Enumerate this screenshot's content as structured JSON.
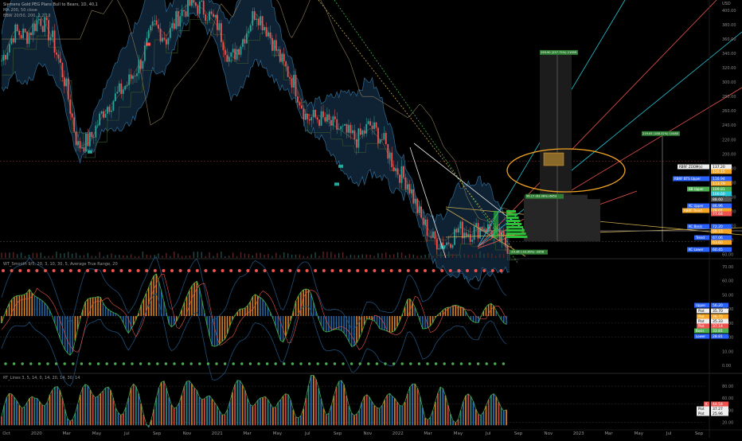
{
  "header": {
    "title": "Siemens Gold PEG Plans Bull to Bears, 1D, 40,1",
    "line2": "MA 200, 50 close",
    "line3": "BBW 20/50, 200, 2.2/13",
    "osc1_label": "WT_Smooth 9/5, 20, 3, 10, 30, 5, Average True Range, 20",
    "osc2_label": "RT_Lines 3, 5, 14, 0, 14, 20, 14, 30, 14"
  },
  "currency": "USD",
  "colors": {
    "up": "#26a69a",
    "down": "#ef5350",
    "red_dot": "#ef5350",
    "green_dot": "#4caf50",
    "orange": "#f5a623",
    "blue": "#2962ff",
    "cyan": "#26c6da",
    "band": "#1e3a52"
  },
  "chart_data": [
    {
      "type": "line",
      "name": "price",
      "x_ticks": [
        "Oct",
        "2020",
        "Mar",
        "May",
        "Jul",
        "Sep",
        "Nov",
        "2021",
        "Mar",
        "May",
        "Jul",
        "Sep",
        "Nov",
        "2022",
        "Mar",
        "May",
        "Jul",
        "Sep",
        "Nov",
        "2023",
        "Mar",
        "May",
        "Jul",
        "Sep"
      ],
      "y_ticks": [
        60,
        80,
        100,
        120,
        140,
        160,
        180,
        200,
        220,
        240,
        260,
        280,
        300,
        320,
        340,
        360,
        380,
        400
      ],
      "ylim": [
        55,
        410
      ],
      "series": [
        {
          "name": "close",
          "values": [
            330,
            370,
            365,
            390,
            360,
            300,
            210,
            220,
            260,
            280,
            300,
            330,
            380,
            360,
            395,
            410,
            400,
            380,
            330,
            360,
            400,
            370,
            330,
            300,
            250,
            250,
            240,
            230,
            220,
            240,
            220,
            180,
            160,
            110,
            80,
            75,
            95,
            90,
            100,
            85,
            70
          ]
        }
      ],
      "price_labels": [
        {
          "label": "RBRF ZOOM(s)",
          "value": "137.20",
          "color": "#ffffff"
        },
        {
          "label": "",
          "value": "126.15",
          "color": "#f5a623"
        },
        {
          "label": "RBRF BTS Upper",
          "value": "116.94",
          "color": "#2962ff"
        },
        {
          "label": "",
          "value": "113.79",
          "color": "#f5a623"
        },
        {
          "label": "BB Upper",
          "value": "109.81",
          "color": "#4caf50"
        },
        {
          "label": "",
          "value": "100.60",
          "color": "#26c6da"
        },
        {
          "label": "",
          "value": "88.60",
          "color": "#555555"
        },
        {
          "label": "KC Upper",
          "value": "86.96",
          "color": "#2962ff"
        },
        {
          "label": "RBRF Trend",
          "value": "78.01",
          "color": "#f5a623"
        },
        {
          "label": "",
          "value": "77.64",
          "color": "#ef5350"
        },
        {
          "label": "KC Basis",
          "value": "72.20",
          "color": "#2962ff"
        },
        {
          "label": "",
          "value": "69.15",
          "color": "#f5a623"
        },
        {
          "label": "Trend",
          "value": "67.06",
          "color": "#2962ff"
        },
        {
          "label": "",
          "value": "63.60",
          "color": "#f5a623"
        },
        {
          "label": "KC Lower",
          "value": "60.45",
          "color": "#2962ff"
        }
      ],
      "annotations": [
        {
          "text": "299.90 (257.75%) 21999",
          "x": "Sep 2022",
          "y": 338
        },
        {
          "text": "219.05 (188.32%) 10480",
          "x": "Jan 2023",
          "y": 225
        },
        {
          "text": "96.17 (63.98%) 6853",
          "x": "Sep 2022",
          "y": 143
        },
        {
          "text": "-29.36 (-33.36%) -2858",
          "x": "Jul 2022",
          "y": 62
        }
      ]
    },
    {
      "type": "area",
      "name": "WT oscillator",
      "y_ticks": [
        0,
        10,
        20,
        30,
        40,
        50,
        60,
        70
      ],
      "ylim": [
        -5,
        75
      ],
      "series": [
        {
          "name": "wt",
          "values": [
            30,
            45,
            60,
            40,
            25,
            10,
            40,
            55,
            35,
            20,
            50,
            60,
            30,
            45,
            55,
            20,
            15,
            40,
            55,
            35,
            20,
            45,
            50,
            30,
            20,
            15,
            35,
            20,
            30,
            45,
            25,
            40,
            35,
            45,
            30,
            40,
            35
          ]
        }
      ],
      "price_labels": [
        {
          "label": "Upper",
          "value": "56.20",
          "color": "#2962ff"
        },
        {
          "label": "Plot",
          "value": "35.70",
          "color": "#ffffff"
        },
        {
          "label": "Plot",
          "value": "36.70",
          "color": "#f5a623"
        },
        {
          "label": "Plot",
          "value": "35.33",
          "color": "#ffffff"
        },
        {
          "label": "Plot",
          "value": "37.14",
          "color": "#ef5350"
        },
        {
          "label": "Basis",
          "value": "33.81",
          "color": "#4caf50"
        },
        {
          "label": "Lower",
          "value": "28.81",
          "color": "#2962ff"
        }
      ]
    },
    {
      "type": "area",
      "name": "RT oscillator",
      "y_ticks": [
        20,
        40,
        60,
        80
      ],
      "ylim": [
        10,
        100
      ],
      "series": [
        {
          "name": "rt",
          "values": [
            30,
            70,
            40,
            80,
            35,
            60,
            85,
            40,
            70,
            30,
            75,
            55,
            90,
            35,
            60,
            80,
            40,
            70,
            30,
            85,
            50,
            75,
            35,
            65,
            45,
            80,
            40,
            60,
            35,
            55,
            45,
            60
          ]
        }
      ],
      "price_labels": [
        {
          "label": "K",
          "value": "44.54",
          "color": "#ef5350"
        },
        {
          "label": "Plot",
          "value": "37.27",
          "color": "#ffffff"
        },
        {
          "label": "Plot",
          "value": "25.96",
          "color": "#ffffff"
        }
      ]
    }
  ]
}
